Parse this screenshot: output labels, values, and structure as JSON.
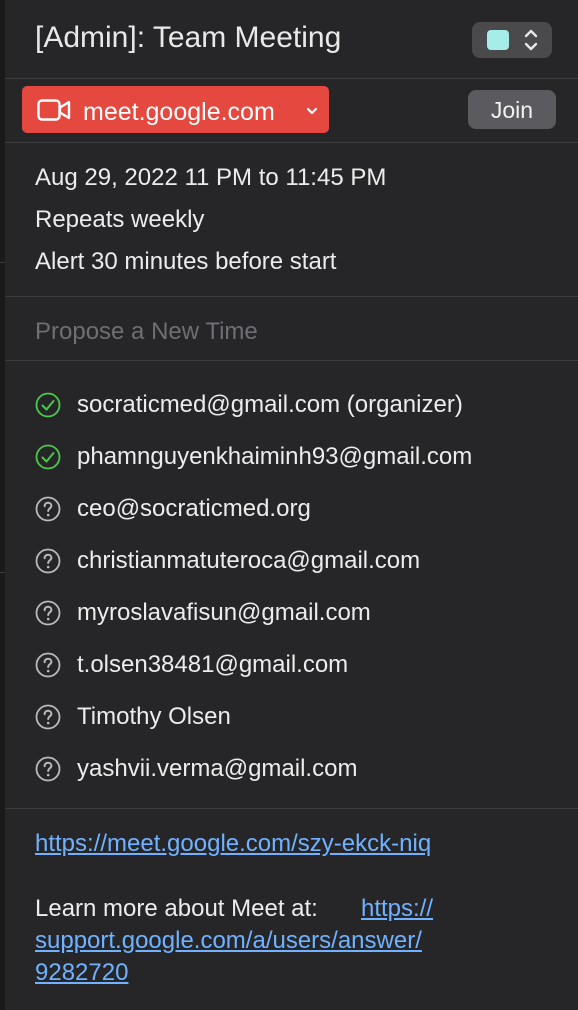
{
  "event": {
    "title": "[Admin]: Team Meeting",
    "calendar_color": "#a6ece9"
  },
  "conference": {
    "label": "meet.google.com",
    "join_label": "Join",
    "accent": "#e4483e"
  },
  "details": {
    "datetime": "Aug 29, 2022  11 PM to 11:45 PM",
    "repeat": "Repeats weekly",
    "alert": "Alert 30 minutes before start"
  },
  "propose_label": "Propose a New Time",
  "attendees": [
    {
      "label": "socraticmed@gmail.com (organizer)",
      "status": "accepted"
    },
    {
      "label": "phamnguyenkhaiminh93@gmail.com",
      "status": "accepted"
    },
    {
      "label": "ceo@socraticmed.org",
      "status": "unknown"
    },
    {
      "label": "christianmatuteroca@gmail.com",
      "status": "unknown"
    },
    {
      "label": "myroslavafisun@gmail.com",
      "status": "unknown"
    },
    {
      "label": "t.olsen38481@gmail.com",
      "status": "unknown"
    },
    {
      "label": "Timothy Olsen",
      "status": "unknown"
    },
    {
      "label": "yashvii.verma@gmail.com",
      "status": "unknown"
    }
  ],
  "notes": {
    "meet_link": "https://meet.google.com/szy-ekck-niq",
    "learn_more_prefix": "Learn more about Meet at: ",
    "support_link_line1": "https://",
    "support_link_line2": "support.google.com/a/users/answer/",
    "support_link_line3": "9282720"
  },
  "icons": {
    "camera": "video-camera-icon",
    "chevron": "chevron-down-icon",
    "stepper": "up-down-chevron-icon",
    "accepted": "checkmark-circle-icon",
    "unknown": "question-circle-icon"
  },
  "colors": {
    "accepted": "#4cc84a",
    "unknown": "#b9b9bc",
    "link": "#70b2ff"
  }
}
